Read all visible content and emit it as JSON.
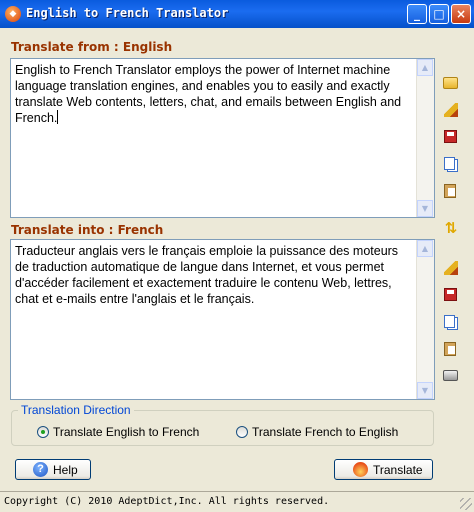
{
  "window": {
    "title": "English to French Translator",
    "buttons": {
      "minimize": "_",
      "maximize": "□",
      "close": "×"
    },
    "icon": "app-logo-icon"
  },
  "source": {
    "label": "Translate from : English",
    "text": "English to French Translator employs the power of Internet machine language translation engines, and enables you to easily and exactly translate Web contents, letters, chat, and emails between English and French."
  },
  "target": {
    "label": "Translate into : French",
    "text": "Traducteur anglais vers le français emploie la puissance des moteurs de traduction automatique de langue dans Internet, et vous permet d'accéder facilement et exactement traduire le contenu Web, lettres, chat et e-mails entre l'anglais et le français."
  },
  "toolbar_icons": [
    "open-folder-icon",
    "clear-broom-icon",
    "save-disk-icon",
    "copy-icon",
    "paste-icon",
    "swap-icon",
    "clear-broom-icon",
    "save-disk-icon",
    "copy-icon",
    "paste-icon",
    "print-icon"
  ],
  "direction": {
    "legend": "Translation Direction",
    "options": [
      {
        "label": "Translate English to French",
        "selected": true
      },
      {
        "label": "Translate French to English",
        "selected": false
      }
    ]
  },
  "buttons": {
    "help": "Help",
    "translate": "Translate"
  },
  "status": {
    "copyright": "Copyright (C) 2010 AdeptDict,Inc. All rights reserved."
  },
  "colors": {
    "section_label": "#993300",
    "titlebar": "#0A5BDE",
    "group_legend": "#0046D5"
  }
}
